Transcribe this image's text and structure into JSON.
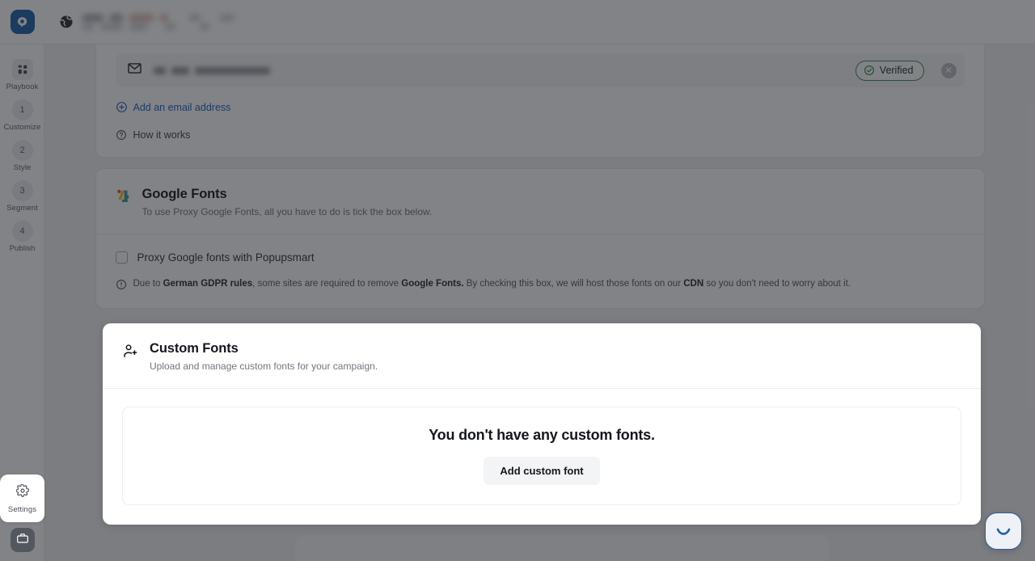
{
  "app": {
    "logo_icon": "popupsmart-logo-icon",
    "globe_icon": "globe-icon"
  },
  "sidebar": {
    "items": [
      {
        "badge": "",
        "icon": "grid-icon",
        "label": "Playbook"
      },
      {
        "badge": "1",
        "icon": "",
        "label": "Customize"
      },
      {
        "badge": "2",
        "icon": "",
        "label": "Style"
      },
      {
        "badge": "3",
        "icon": "",
        "label": "Segment"
      },
      {
        "badge": "4",
        "icon": "",
        "label": "Publish"
      }
    ],
    "settings": {
      "label": "Settings",
      "icon": "gear-icon"
    },
    "briefcase": {
      "icon": "briefcase-icon"
    }
  },
  "email_panel": {
    "mail_icon": "mail-icon",
    "verified_label": "Verified",
    "verified_icon": "check-circle-icon",
    "verified_color": "#2e9150",
    "close_icon": "close-icon",
    "add_email_label": "Add an email address",
    "add_email_icon": "plus-circle-icon",
    "add_email_color": "#1a62c4",
    "how_it_works_label": "How it works",
    "how_it_works_icon": "question-circle-icon"
  },
  "google_fonts": {
    "icon": "google-fonts-icon",
    "title": "Google Fonts",
    "subtitle": "To use Proxy Google Fonts, all you have to do is tick the box below.",
    "checkbox_label": "Proxy Google fonts with Popupsmart",
    "checkbox_checked": false,
    "info_icon": "exclamation-circle-icon",
    "gdpr_part1": "Due to ",
    "gdpr_bold1": "German GDPR rules",
    "gdpr_part2": ", some sites are required to remove ",
    "gdpr_bold2": "Google Fonts.",
    "gdpr_part3": " By checking this box, we will host those fonts on our ",
    "gdpr_bold3": "CDN",
    "gdpr_part4": " so you don't need to worry about it."
  },
  "custom_fonts": {
    "icon": "users-add-icon",
    "title": "Custom Fonts",
    "subtitle": "Upload and manage custom fonts for your campaign.",
    "empty_title": "You don't have any custom fonts.",
    "add_button_label": "Add custom font"
  },
  "chat": {
    "icon": "chat-smile-icon",
    "accent_color": "#2c5f9e"
  }
}
